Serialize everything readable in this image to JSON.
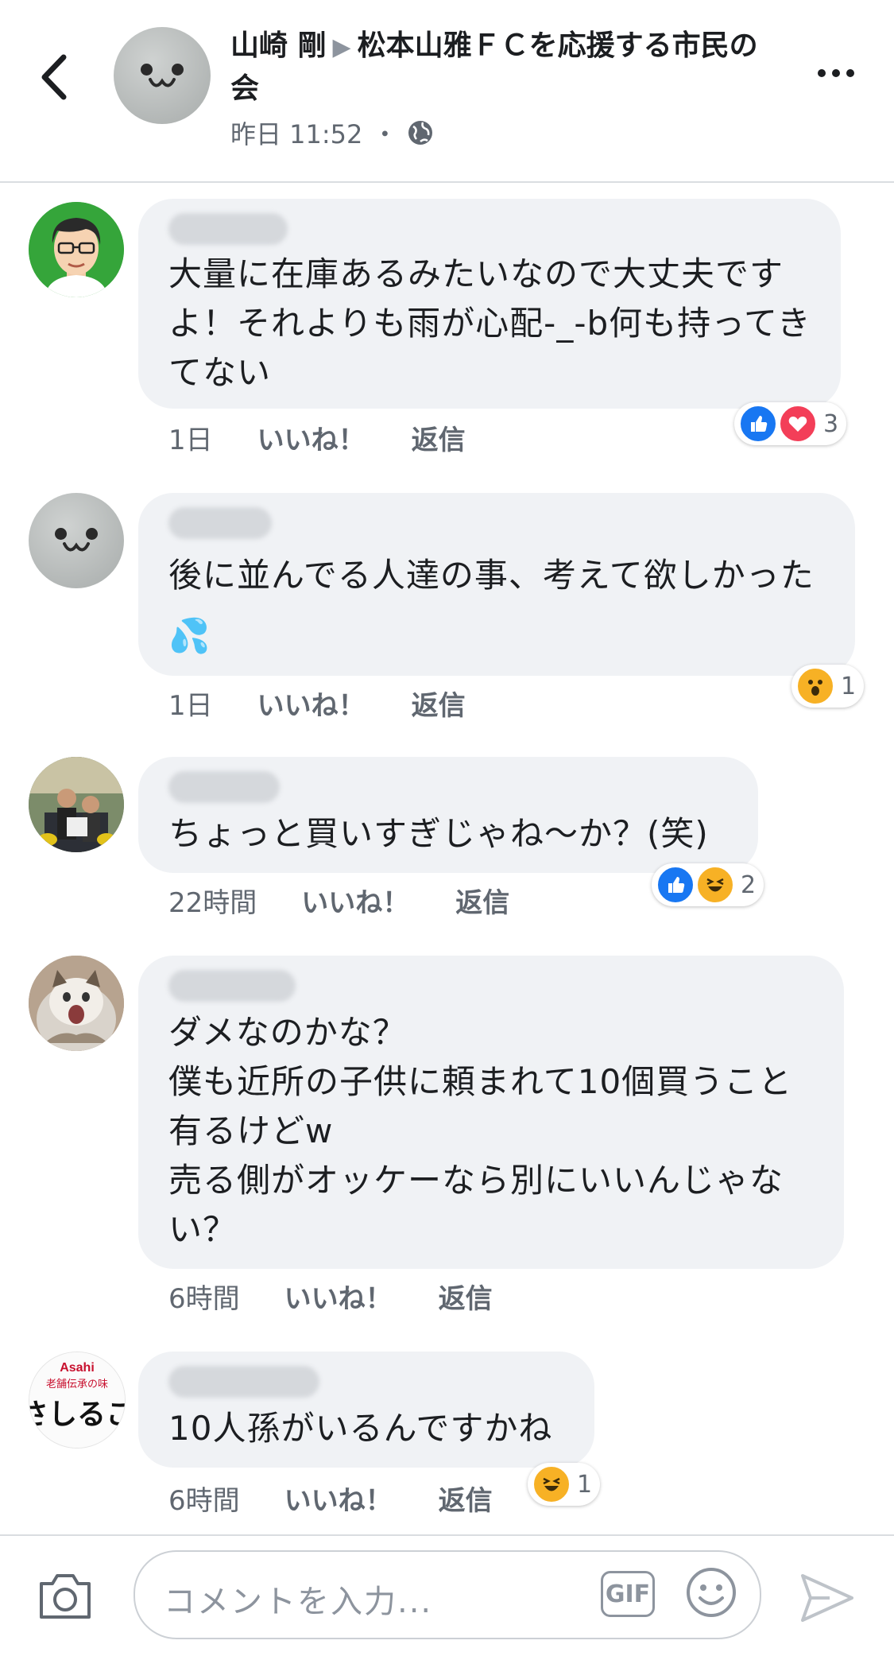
{
  "header": {
    "author": "山崎 剛",
    "group": "松本山雅ＦＣを応援する市民の会",
    "time": "昨日 11:52",
    "separator": "・"
  },
  "comments": [
    {
      "text": "大量に在庫あるみたいなので大丈夫ですよ！それよりも雨が心配-_-b何も持ってきてない",
      "time": "1日",
      "reactions": [
        "like",
        "love"
      ],
      "reaction_count": "3"
    },
    {
      "text": "後に並んでる人達の事、考えて欲しかった💦",
      "time": "1日",
      "reactions": [
        "wow"
      ],
      "reaction_count": "1"
    },
    {
      "text": "ちょっと買いすぎじゃね〜か？(笑)",
      "time": "22時間",
      "reactions": [
        "like",
        "haha"
      ],
      "reaction_count": "2"
    },
    {
      "text": "ダメなのかな？\n僕も近所の子供に頼まれて10個買うこと有るけどw\n売る側がオッケーなら別にいいんじゃない？",
      "time": "6時間",
      "reactions": [],
      "reaction_count": ""
    },
    {
      "text": "10人孫がいるんですかね",
      "time": "6時間",
      "reactions": [
        "haha"
      ],
      "reaction_count": "1"
    }
  ],
  "actions": {
    "like_label": "いいね！",
    "reply_label": "返信"
  },
  "avatar5_text": {
    "top": "Asahi",
    "mid": "老舗伝承の味",
    "big": "さしるこ"
  },
  "composer": {
    "placeholder": "コメントを入力...",
    "gif_label": "GIF"
  },
  "icons": [
    "back-chevron-icon",
    "globe-icon",
    "more-icon",
    "camera-icon",
    "gif-icon",
    "emoji-icon",
    "send-icon",
    "like-reaction-icon",
    "love-reaction-icon",
    "wow-reaction-icon",
    "haha-reaction-icon"
  ],
  "colors": {
    "like_blue": "#1877f2",
    "love_red": "#f33e58",
    "emoji_yellow": "#f7b125",
    "bubble_bg": "#f0f2f5"
  }
}
